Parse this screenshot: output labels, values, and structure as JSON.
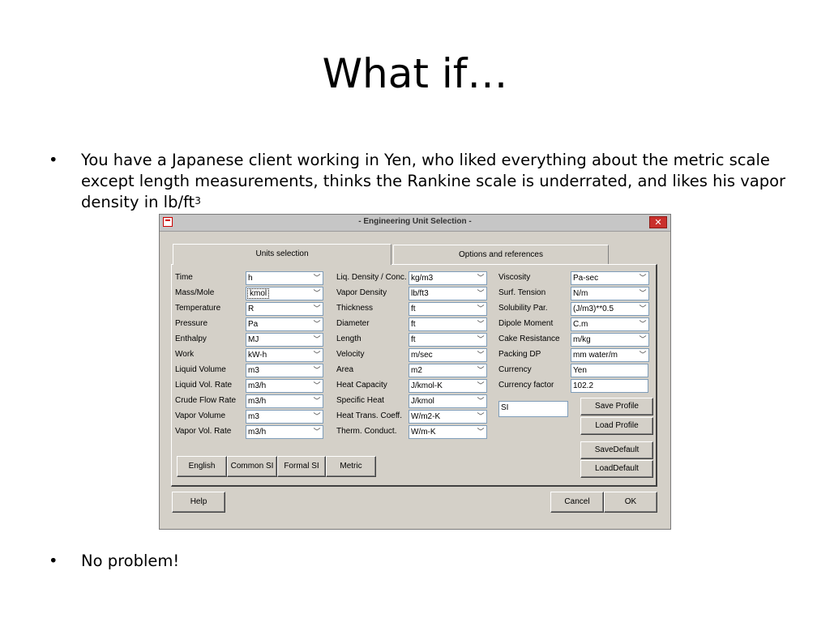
{
  "slide": {
    "title": "What if…",
    "bullet1_dot": "•",
    "bullet1_text": "You have a Japanese client working in Yen, who liked everything about the metric scale except length measurements, thinks the Rankine scale is underrated, and likes his vapor density in lb/ft",
    "bullet1_sup": "3",
    "bullet2_dot": "•",
    "bullet2_text": "No problem!"
  },
  "dialog": {
    "title": "- Engineering Unit Selection -",
    "close_glyph": "✕",
    "tabs": {
      "units": "Units selection",
      "options": "Options and references"
    },
    "col1": [
      {
        "label": "Time",
        "value": "h"
      },
      {
        "label": "Mass/Mole",
        "value": "kmol"
      },
      {
        "label": "Temperature",
        "value": "R"
      },
      {
        "label": "Pressure",
        "value": "Pa"
      },
      {
        "label": "Enthalpy",
        "value": "MJ"
      },
      {
        "label": "Work",
        "value": "kW-h"
      },
      {
        "label": "Liquid Volume",
        "value": "m3"
      },
      {
        "label": "Liquid Vol. Rate",
        "value": "m3/h"
      },
      {
        "label": "Crude Flow Rate",
        "value": "m3/h"
      },
      {
        "label": "Vapor Volume",
        "value": "m3"
      },
      {
        "label": "Vapor Vol. Rate",
        "value": "m3/h"
      }
    ],
    "col2": [
      {
        "label": "Liq. Density / Conc.",
        "value": "kg/m3"
      },
      {
        "label": "Vapor Density",
        "value": "lb/ft3"
      },
      {
        "label": "Thickness",
        "value": "ft"
      },
      {
        "label": "Diameter",
        "value": "ft"
      },
      {
        "label": "Length",
        "value": "ft"
      },
      {
        "label": "Velocity",
        "value": "m/sec"
      },
      {
        "label": "Area",
        "value": "m2"
      },
      {
        "label": "Heat Capacity",
        "value": "J/kmol-K"
      },
      {
        "label": "Specific Heat",
        "value": "J/kmol"
      },
      {
        "label": "Heat Trans. Coeff.",
        "value": "W/m2-K"
      },
      {
        "label": "Therm. Conduct.",
        "value": "W/m-K"
      }
    ],
    "col3": [
      {
        "label": "Viscosity",
        "value": "Pa-sec"
      },
      {
        "label": "Surf. Tension",
        "value": "N/m"
      },
      {
        "label": "Solubility Par.",
        "value": "(J/m3)**0.5"
      },
      {
        "label": "Dipole Moment",
        "value": "C.m"
      },
      {
        "label": "Cake Resistance",
        "value": "m/kg"
      },
      {
        "label": "Packing DP",
        "value": "mm water/m"
      }
    ],
    "currency_label": "Currency",
    "currency_value": "Yen",
    "currency_factor_label": "Currency factor",
    "currency_factor_value": "102.2",
    "profile_name": "SI",
    "buttons": {
      "save_profile": "Save Profile",
      "load_profile": "Load Profile",
      "save_default": "SaveDefault",
      "load_default": "LoadDefault",
      "english": "English",
      "common_si": "Common SI",
      "formal_si": "Formal SI",
      "metric": "Metric",
      "help": "Help",
      "cancel": "Cancel",
      "ok": "OK"
    },
    "arrow_glyph": "﹀"
  }
}
